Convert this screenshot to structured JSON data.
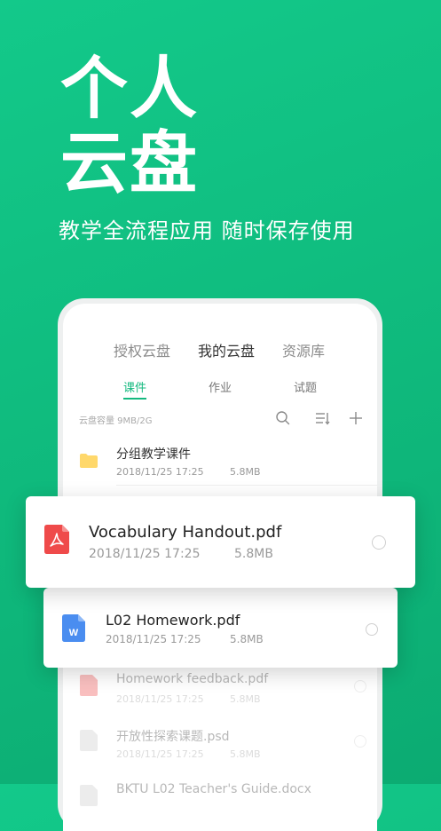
{
  "hero": {
    "title_line1": "个人",
    "title_line2": "云盘",
    "subtitle": "教学全流程应用 随时保存使用"
  },
  "tabs": [
    {
      "label": "授权云盘",
      "active": false
    },
    {
      "label": "我的云盘",
      "active": true
    },
    {
      "label": "资源库",
      "active": false
    }
  ],
  "subtabs": [
    {
      "label": "课件",
      "active": true
    },
    {
      "label": "作业",
      "active": false
    },
    {
      "label": "试题",
      "active": false
    }
  ],
  "capacity": "云盘容量 9MB/2G",
  "toolbar": {
    "icons": [
      "search-icon",
      "sort-icon",
      "add-icon"
    ]
  },
  "files": [
    {
      "name": "分组教学课件",
      "date": "2018/11/25  17:25",
      "size": "5.8MB",
      "icon": "folder-icon"
    },
    {
      "name": "Vocabulary Handout.pdf",
      "date": "2018/11/25  17:25",
      "size": "5.8MB",
      "icon": "pdf-icon"
    },
    {
      "name": "L02 Homework.pdf",
      "date": "2018/11/25  17:25",
      "size": "5.8MB",
      "icon": "word-icon"
    },
    {
      "name": "Homework feedback.pdf",
      "date": "2018/11/25  17:25",
      "size": "5.8MB",
      "icon": "pdf-icon"
    },
    {
      "name": "开放性探索课题.psd",
      "date": "2018/11/25  17:25",
      "size": "5.8MB",
      "icon": "psd-icon"
    },
    {
      "name": "BKTU L02 Teacher's Guide.docx",
      "icon": "doc-icon"
    }
  ],
  "colors": {
    "brand": "#14b97f",
    "pdf": "#ef4a4a",
    "word": "#4a8df0",
    "folder": "#ffd86b"
  }
}
